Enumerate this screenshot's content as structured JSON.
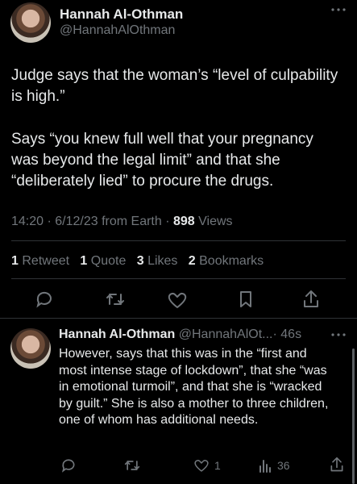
{
  "main_tweet": {
    "author_name": "Hannah Al-Othman",
    "author_handle": "@HannahAlOthman",
    "paragraph1": "Judge says that the woman’s “level of culpability is high.”",
    "paragraph2": "Says “you knew full well that your pregnancy was beyond the legal limit” and that she “deliberately lied” to procure the drugs.",
    "meta_time": "14:20 · 6/12/23 from Earth · ",
    "meta_views_count": "898",
    "meta_views_label": " Views",
    "stats": {
      "retweets_count": "1",
      "retweets_label": "Retweet",
      "quotes_count": "1",
      "quotes_label": "Quote",
      "likes_count": "3",
      "likes_label": "Likes",
      "bookmarks_count": "2",
      "bookmarks_label": "Bookmarks"
    },
    "more_icon": "ellipsis-icon"
  },
  "reply_tweet": {
    "author_name": "Hannah Al-Othman",
    "author_handle": "@HannahAlOt...",
    "time": "· 46s",
    "text": "However, says that this was in the “first and most intense stage of lockdown”, that she “was in emotional turmoil”, and that she is “wracked by guilt.” She is also a mother to three children, one of whom has additional needs.",
    "actions": {
      "likes_count": "1",
      "views_count": "36"
    }
  },
  "colors": {
    "background": "#000000",
    "text": "#e7e9ea",
    "muted": "#71767b",
    "divider": "#2f3336"
  }
}
